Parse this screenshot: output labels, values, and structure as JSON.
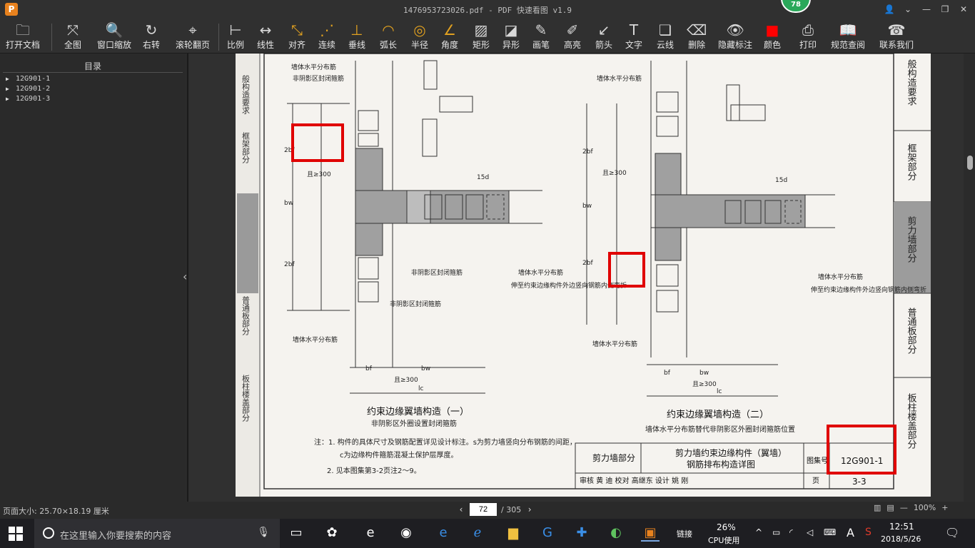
{
  "window": {
    "logo": "P",
    "title": "1476953723026.pdf - PDF 快速看图 v1.9",
    "badge": "78"
  },
  "toolbar": {
    "tools": [
      {
        "id": "open",
        "label": "打开文档",
        "icon": "folder-icon",
        "glyph": "🗀"
      },
      {
        "id": "fit-all",
        "label": "全图",
        "icon": "fit-all-icon",
        "glyph": "⤧"
      },
      {
        "id": "window-zoom",
        "label": "窗口缩放",
        "icon": "zoom-icon",
        "glyph": "🔍"
      },
      {
        "id": "rotate-right",
        "label": "右转",
        "icon": "rotate-right-icon",
        "glyph": "↻"
      },
      {
        "id": "wheel-page",
        "label": "滚轮翻页",
        "icon": "mouse-icon",
        "glyph": "⌖"
      },
      {
        "id": "scale",
        "label": "比例",
        "icon": "ruler-icon",
        "glyph": "⊢"
      },
      {
        "id": "linear",
        "label": "线性",
        "icon": "linear-dim-icon",
        "glyph": "↔"
      },
      {
        "id": "align",
        "label": "对齐",
        "icon": "aligned-dim-icon",
        "glyph": "⤡"
      },
      {
        "id": "continuous",
        "label": "连续",
        "icon": "continuous-dim-icon",
        "glyph": "⋰"
      },
      {
        "id": "perpendicular",
        "label": "垂线",
        "icon": "perpendicular-icon",
        "glyph": "⊥"
      },
      {
        "id": "arc-length",
        "label": "弧长",
        "icon": "arc-icon",
        "glyph": "◠"
      },
      {
        "id": "radius",
        "label": "半径",
        "icon": "radius-icon",
        "glyph": "◎"
      },
      {
        "id": "angle",
        "label": "角度",
        "icon": "angle-icon",
        "glyph": "∠"
      },
      {
        "id": "rect",
        "label": "矩形",
        "icon": "rect-area-icon",
        "glyph": "▨"
      },
      {
        "id": "polygon",
        "label": "异形",
        "icon": "polygon-area-icon",
        "glyph": "◪"
      },
      {
        "id": "pen",
        "label": "画笔",
        "icon": "pen-icon",
        "glyph": "✎"
      },
      {
        "id": "highlight",
        "label": "高亮",
        "icon": "highlighter-icon",
        "glyph": "✐"
      },
      {
        "id": "arrow",
        "label": "箭头",
        "icon": "arrow-icon",
        "glyph": "↙"
      },
      {
        "id": "text",
        "label": "文字",
        "icon": "text-icon",
        "glyph": "T"
      },
      {
        "id": "cloud",
        "label": "云线",
        "icon": "cloud-line-icon",
        "glyph": "❏"
      },
      {
        "id": "delete",
        "label": "删除",
        "icon": "eraser-icon",
        "glyph": "⌫"
      },
      {
        "id": "hide-marks",
        "label": "隐藏标注",
        "icon": "eye-hide-icon",
        "glyph": "👁"
      },
      {
        "id": "color",
        "label": "颜色",
        "icon": "color-swatch-icon",
        "glyph": "■"
      },
      {
        "id": "print",
        "label": "打印",
        "icon": "printer-icon",
        "glyph": "⎙"
      },
      {
        "id": "spec",
        "label": "规范查阅",
        "icon": "book-icon",
        "glyph": "📖"
      },
      {
        "id": "contact",
        "label": "联系我们",
        "icon": "headset-icon",
        "glyph": "☎"
      }
    ],
    "accent": "#e0a020",
    "swatch_color": "#ff0000"
  },
  "sidebar": {
    "title": "目录",
    "items": [
      "12G901-1",
      "12G901-2",
      "12G901-3"
    ]
  },
  "drawing": {
    "left_tabs": [
      "般构造要求",
      "框架部分",
      "普通板部分",
      "板柱楼盖部分"
    ],
    "right_tabs": [
      "般构造要求",
      "框架部分",
      "剪力墙部分",
      "普通板部分",
      "板柱楼盖部分"
    ],
    "labels": {
      "wall_dist": "墙体水平分布筋",
      "non_shadow_hoop": "非阴影区封闭箍筋",
      "extend": "伸至约束边缘构件外边竖向钢筋内侧弯折",
      "dim_2bf": "2bf",
      "dim_bw": "bw",
      "dim_bf": "bf",
      "dim_s": "s",
      "dim_300": "且≥300",
      "dim_15d": "15d",
      "dim_lc": "lc",
      "dim_c": "c"
    },
    "detail1_title": "约束边缘翼墙构造（一）",
    "detail1_sub": "非阴影区外圈设置封闭箍筋",
    "detail2_title": "约束边缘翼墙构造（二）",
    "detail2_sub": "墙体水平分布筋替代非阴影区外圈封闭箍筋位置",
    "notes": [
      "注：1. 构件的具体尺寸及钢筋配置详见设计标注。s为剪力墙竖向分布钢筋的间距，",
      "c为边缘构件箍筋混凝土保护层厚度。",
      "2. 见本图集第3-2页注2～9。"
    ],
    "titleblock": {
      "section": "剪力墙部分",
      "name1": "剪力墙约束边缘构件（翼墙）",
      "name2": "钢筋排布构造详图",
      "atlas_label": "图集号",
      "atlas_no": "12G901-1",
      "page_label": "页",
      "page_no": "3-3",
      "review_row": "审核 黄 迪 校对 高继东 设计 姚 刚"
    },
    "mark_color": "#e00000"
  },
  "status": {
    "page_size": "页面大小: 25.70×18.19 厘米",
    "current_page": "72",
    "total_pages": "/ 305",
    "zoom": "100%"
  },
  "taskbar": {
    "search_placeholder": "在这里输入你要搜索的内容",
    "link_label": "链接",
    "cpu_percent": "26%",
    "cpu_label": "CPU使用",
    "time": "12:51",
    "date": "2018/5/26",
    "lang": "A"
  }
}
